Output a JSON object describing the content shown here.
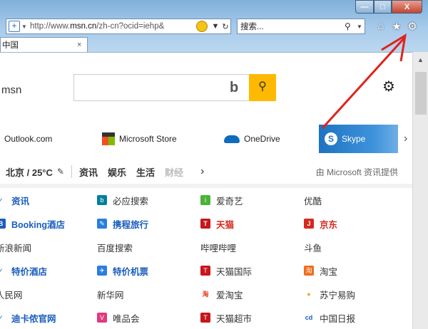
{
  "window": {
    "min_label": "—",
    "max_label": "□",
    "close_label": "X"
  },
  "address": {
    "url_prefix": "http://www.",
    "url_domain": "msn.cn",
    "url_rest": "/zh-cn?ocid=iehp&",
    "refresh_icon": "↻",
    "dropdown_icon": "▼"
  },
  "search": {
    "placeholder": "搜索...",
    "icon": "⚲",
    "dropdown_icon": "▼"
  },
  "toolbar": {
    "home_icon": "⌂",
    "favorites_icon": "★",
    "tools_icon": "⚙"
  },
  "tab": {
    "title": "中国",
    "close_icon": "×"
  },
  "page": {
    "brand": "msn",
    "search_button_icon": "⚲",
    "bing_logo": "b",
    "settings_icon": "⚙"
  },
  "quicklinks": [
    {
      "label": "Outlook.com"
    },
    {
      "label": "Microsoft Store"
    },
    {
      "label": "OneDrive"
    },
    {
      "label": "Skype"
    }
  ],
  "quicklinks_next": "›",
  "nav": {
    "weather": "北京 / 25°C",
    "items": [
      "资讯",
      "娱乐",
      "生活",
      "财经"
    ],
    "next": "›",
    "provider": "由 Microsoft 资讯提供"
  },
  "links": [
    [
      "资讯",
      "必应搜索",
      "爱奇艺",
      "优酷"
    ],
    [
      "Booking酒店",
      "携程旅行",
      "天猫",
      "京东"
    ],
    [
      "新浪新闻",
      "百度搜索",
      "哔哩哔哩",
      "斗鱼"
    ],
    [
      "特价酒店",
      "特价机票",
      "天猫国际",
      "淘宝"
    ],
    [
      "人民网",
      "新华网",
      "爱淘宝",
      "苏宁易购"
    ],
    [
      "迪卡侬官网",
      "唯品会",
      "天猫超市",
      "中国日报"
    ]
  ],
  "colors": {
    "bing_yellow": "#ffb900",
    "link_blue": "#1a5dbf",
    "link_red": "#d6281e",
    "annotation_red": "#e0231c"
  }
}
